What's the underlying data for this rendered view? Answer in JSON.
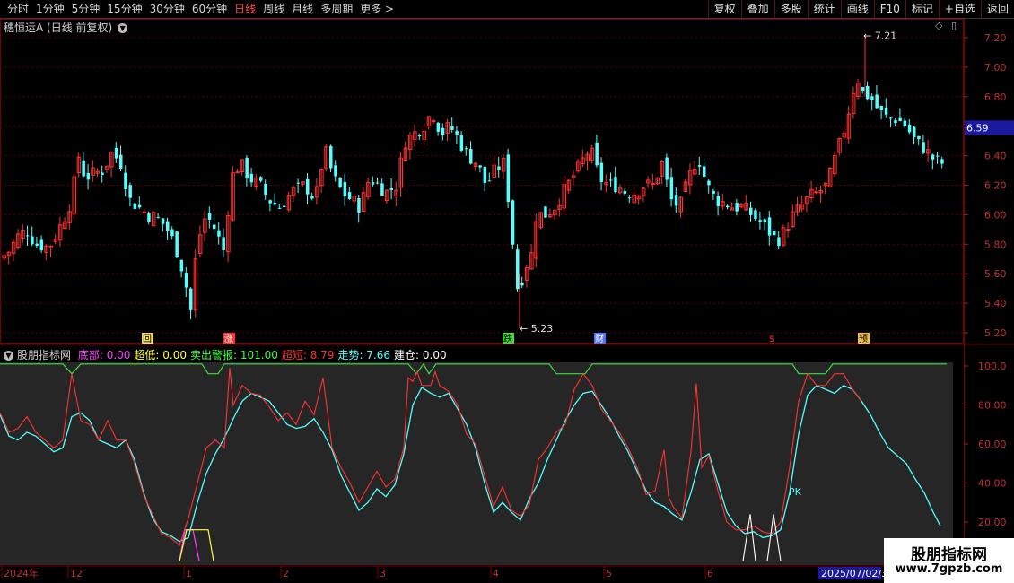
{
  "toolbar": {
    "periods": [
      "分时",
      "1分钟",
      "5分钟",
      "15分钟",
      "30分钟",
      "60分钟",
      "日线",
      "周线",
      "月线",
      "多周期",
      "更多 >"
    ],
    "active_period": "日线",
    "actions": [
      "复权",
      "叠加",
      "多股",
      "统计",
      "画线",
      "F10",
      "标记",
      "+自选",
      "返回"
    ]
  },
  "price_chart": {
    "title": "穗恒运A (日线 前复权)",
    "y_ticks": [
      "7.20",
      "7.00",
      "6.80",
      "6.60",
      "6.40",
      "6.20",
      "6.00",
      "5.80",
      "5.60",
      "5.40",
      "5.20"
    ],
    "current_price": "6.59",
    "high_label": "7.21",
    "low_label": "5.23",
    "event_markers": [
      "回",
      "涨",
      "跌",
      "财",
      "$",
      "预"
    ],
    "colors": {
      "up": "#ff3232",
      "down": "#54ffff",
      "current_bg": "#1a1aa0"
    }
  },
  "indicator": {
    "name": "股朋指标网",
    "values": [
      {
        "label": "底部",
        "value": "0.00",
        "color": "#ff40ff"
      },
      {
        "label": "超低",
        "value": "0.00",
        "color": "#ffff40"
      },
      {
        "label": "卖出警报",
        "value": "101.00",
        "color": "#40ff40"
      },
      {
        "label": "超短",
        "value": "8.79",
        "color": "#ff3232"
      },
      {
        "label": "走势",
        "value": "7.66",
        "color": "#54ffff"
      },
      {
        "label": "建仓",
        "value": "0.00",
        "color": "#ffffff"
      }
    ],
    "y_ticks": [
      "100.0",
      "80.00",
      "60.00",
      "40.00",
      "20.00"
    ],
    "pk_label": "PK"
  },
  "date_axis": {
    "labels": [
      "2024年",
      "12",
      "1",
      "2",
      "3",
      "4",
      "5",
      "6"
    ],
    "current_date": "2025/07/02/3"
  },
  "watermark": {
    "name": "股朋指标网",
    "url": "www.7gpzb.com"
  }
}
